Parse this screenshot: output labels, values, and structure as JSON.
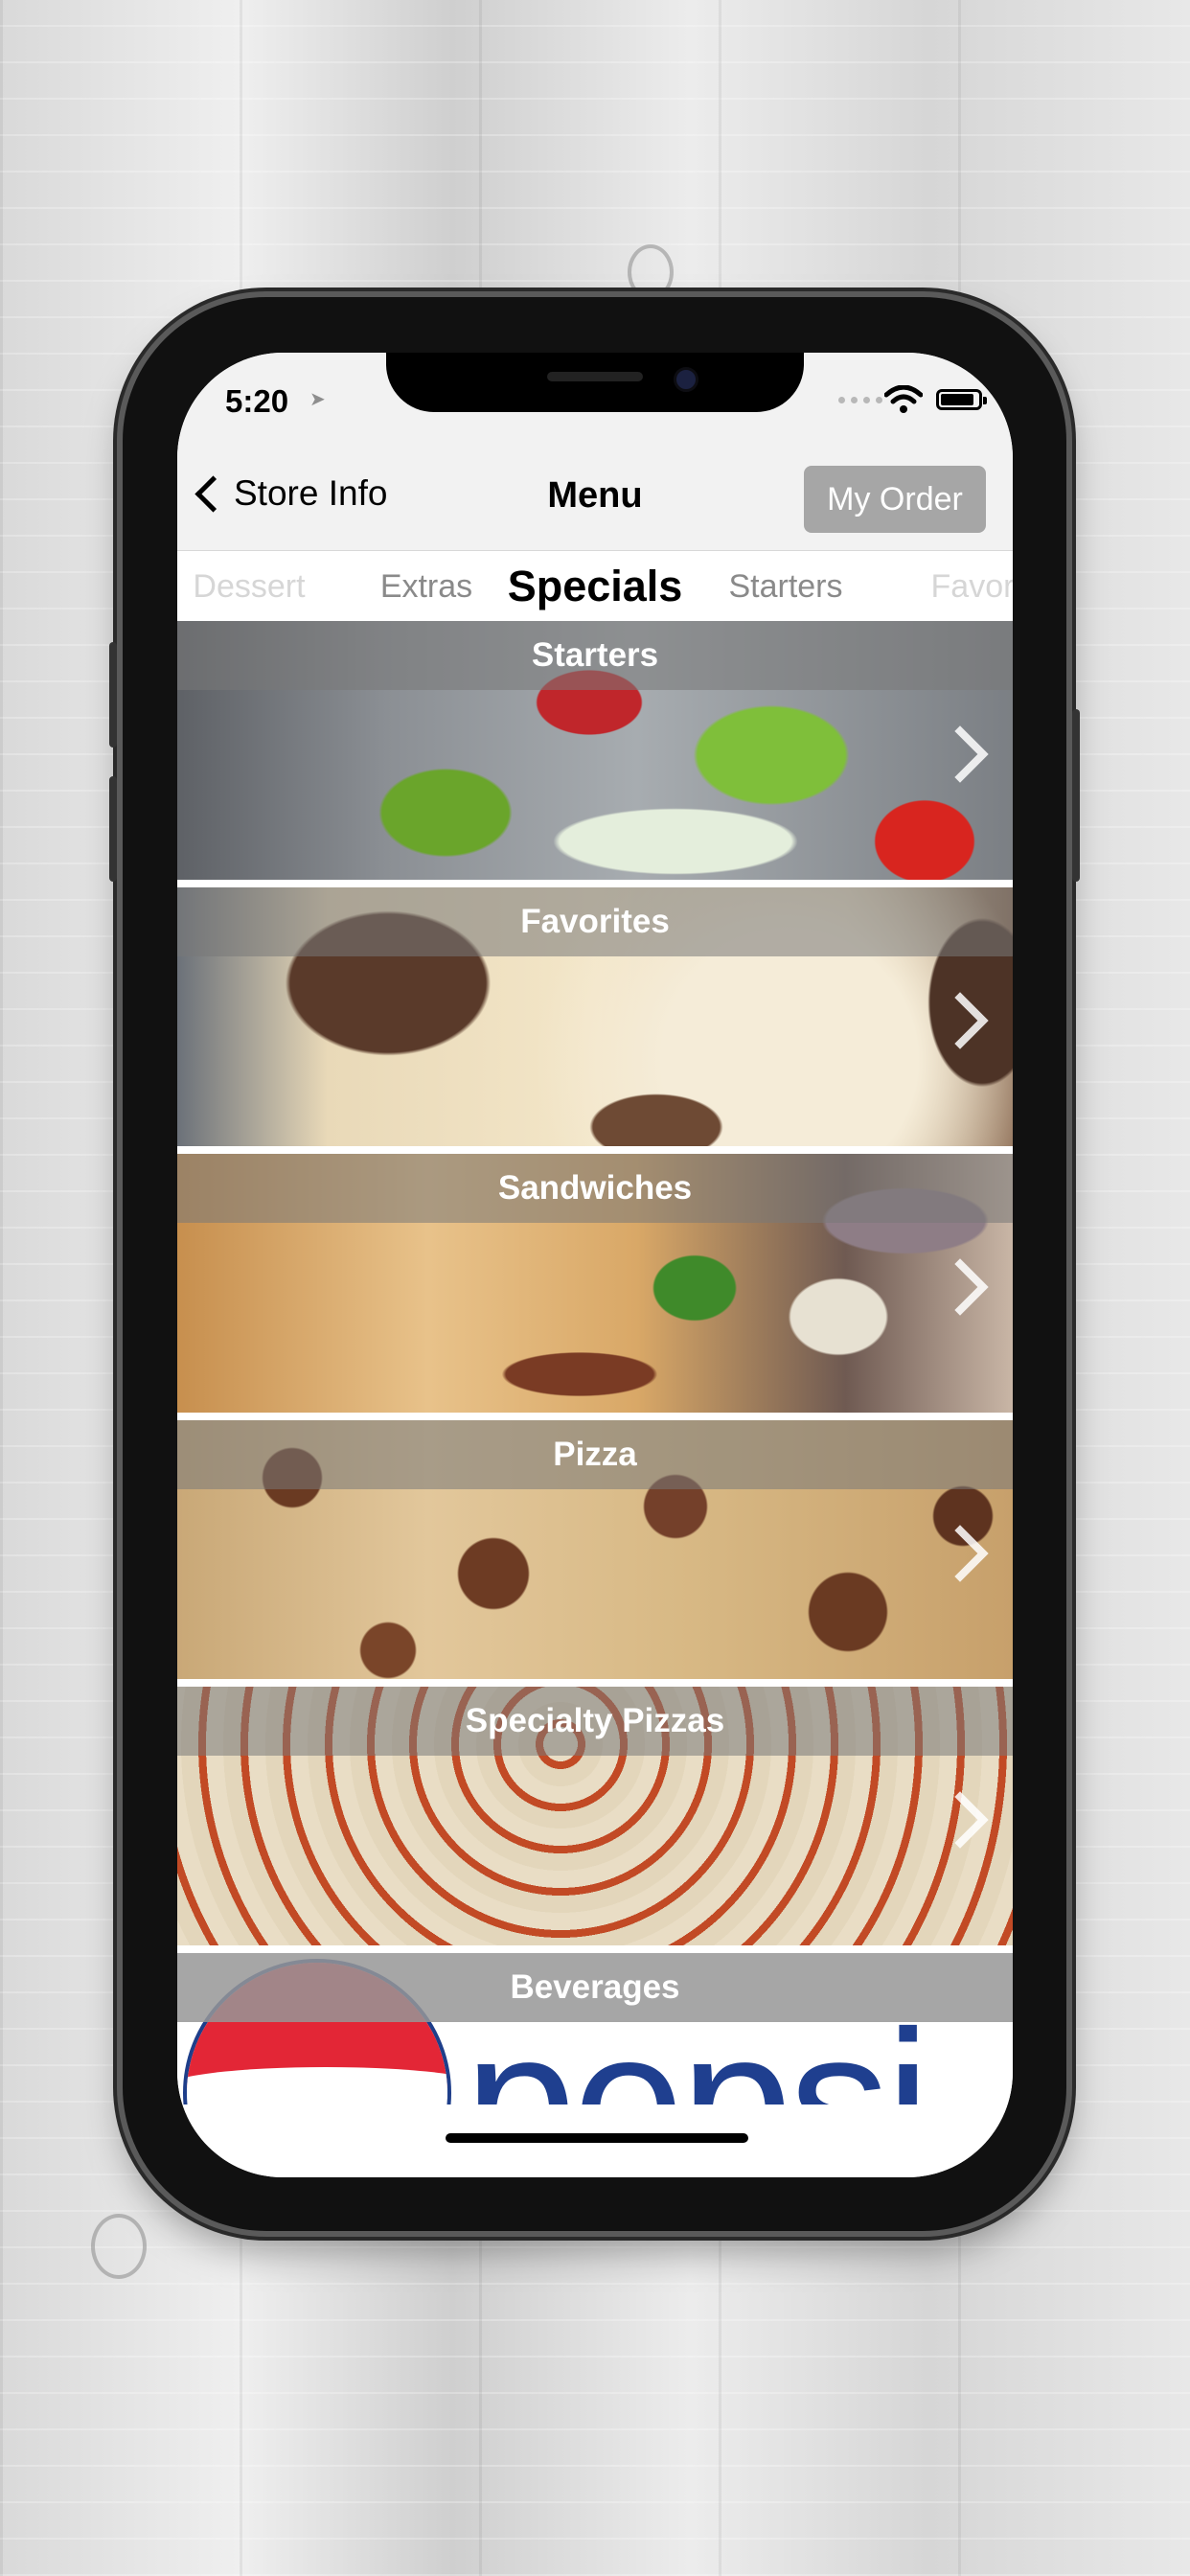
{
  "status_bar": {
    "time": "5:20",
    "icons": [
      "location-arrow-icon",
      "signal-dots-icon",
      "wifi-icon",
      "battery-icon"
    ]
  },
  "nav": {
    "back_label": "Store Info",
    "title": "Menu",
    "order_button": "My Order"
  },
  "tabs": [
    {
      "label": "Dessert",
      "state": "faded"
    },
    {
      "label": "Extras",
      "state": "normal"
    },
    {
      "label": "Specials",
      "state": "selected"
    },
    {
      "label": "Starters",
      "state": "normal"
    },
    {
      "label": "Favor",
      "state": "faded"
    }
  ],
  "categories": [
    {
      "label": "Starters"
    },
    {
      "label": "Favorites"
    },
    {
      "label": "Sandwiches"
    },
    {
      "label": "Pizza"
    },
    {
      "label": "Specialty Pizzas"
    },
    {
      "label": "Beverages",
      "logo_text": "pepsi"
    }
  ],
  "colors": {
    "order_button_bg": "#a6a6a6",
    "label_band": "rgba(120,120,120,0.55)",
    "nav_bg": "#f2f2f2"
  }
}
